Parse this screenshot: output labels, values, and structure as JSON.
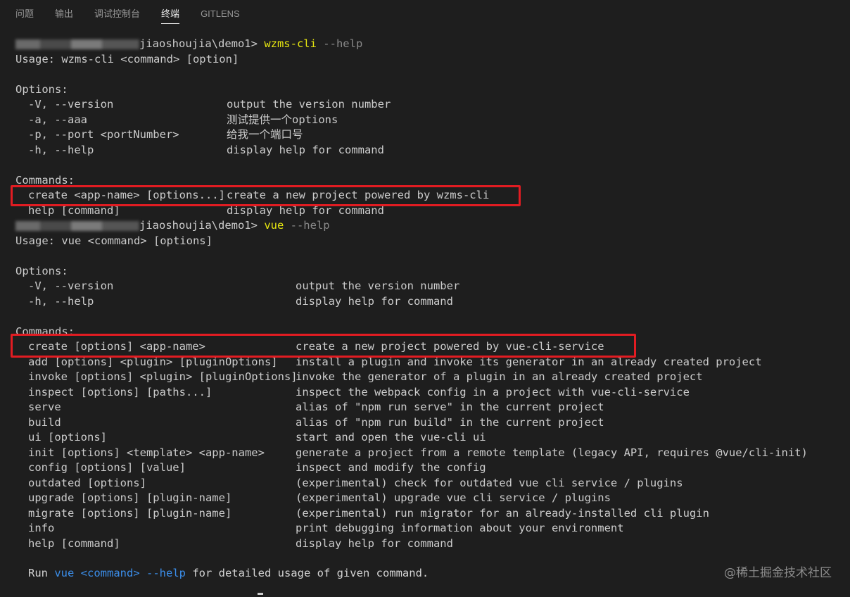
{
  "tabs": [
    "问题",
    "输出",
    "调试控制台",
    "终端",
    "GITLENS"
  ],
  "active_tab": "终端",
  "terminal": {
    "prompt1": {
      "path": "jiaoshoujia\\demo1> ",
      "cmd": "wzms-cli",
      "arg": " --help"
    },
    "usage1": "Usage: wzms-cli <command> [option]",
    "options_header": "Options:",
    "wzms_options": [
      {
        "flag": "-V, --version",
        "desc": "output the version number"
      },
      {
        "flag": "-a, --aaa",
        "desc": "测试提供一个options"
      },
      {
        "flag": "-p, --port <portNumber>",
        "desc": "给我一个端口号"
      },
      {
        "flag": "-h, --help",
        "desc": "display help for command"
      }
    ],
    "commands_header": "Commands:",
    "wzms_commands": [
      {
        "cmd": "create <app-name> [options...]",
        "desc": "create a new project powered by wzms-cli"
      },
      {
        "cmd": "help [command]",
        "desc": "display help for command"
      }
    ],
    "prompt2": {
      "path": "jiaoshoujia\\demo1> ",
      "cmd": "vue",
      "arg": " --help"
    },
    "usage2": "Usage: vue <command> [options]",
    "vue_options": [
      {
        "flag": "-V, --version",
        "desc": "output the version number"
      },
      {
        "flag": "-h, --help",
        "desc": "display help for command"
      }
    ],
    "vue_commands": [
      {
        "cmd": "create [options] <app-name>",
        "desc": "create a new project powered by vue-cli-service"
      },
      {
        "cmd": "add [options] <plugin> [pluginOptions]",
        "desc": "install a plugin and invoke its generator in an already created project"
      },
      {
        "cmd": "invoke [options] <plugin> [pluginOptions]",
        "desc": "invoke the generator of a plugin in an already created project"
      },
      {
        "cmd": "inspect [options] [paths...]",
        "desc": "inspect the webpack config in a project with vue-cli-service"
      },
      {
        "cmd": "serve",
        "desc": "alias of \"npm run serve\" in the current project"
      },
      {
        "cmd": "build",
        "desc": "alias of \"npm run build\" in the current project"
      },
      {
        "cmd": "ui [options]",
        "desc": "start and open the vue-cli ui"
      },
      {
        "cmd": "init [options] <template> <app-name>",
        "desc": "generate a project from a remote template (legacy API, requires @vue/cli-init)"
      },
      {
        "cmd": "config [options] [value]",
        "desc": "inspect and modify the config"
      },
      {
        "cmd": "outdated [options]",
        "desc": "(experimental) check for outdated vue cli service / plugins"
      },
      {
        "cmd": "upgrade [options] [plugin-name]",
        "desc": "(experimental) upgrade vue cli service / plugins"
      },
      {
        "cmd": "migrate [options] [plugin-name]",
        "desc": "(experimental) run migrator for an already-installed cli plugin"
      },
      {
        "cmd": "info",
        "desc": "print debugging information about your environment"
      },
      {
        "cmd": "help [command]",
        "desc": "display help for command"
      }
    ],
    "footer": {
      "run": "Run ",
      "vue": "vue",
      "command": " <command>",
      "help": " --help",
      "rest": " for detailed usage of given command."
    }
  },
  "watermark": "@稀土掘金技术社区",
  "colors": {
    "background": "#1e1e1e",
    "text": "#cccccc",
    "command_yellow": "#e5e510",
    "link_blue": "#3b8eea",
    "highlight_red": "#e21c22"
  }
}
